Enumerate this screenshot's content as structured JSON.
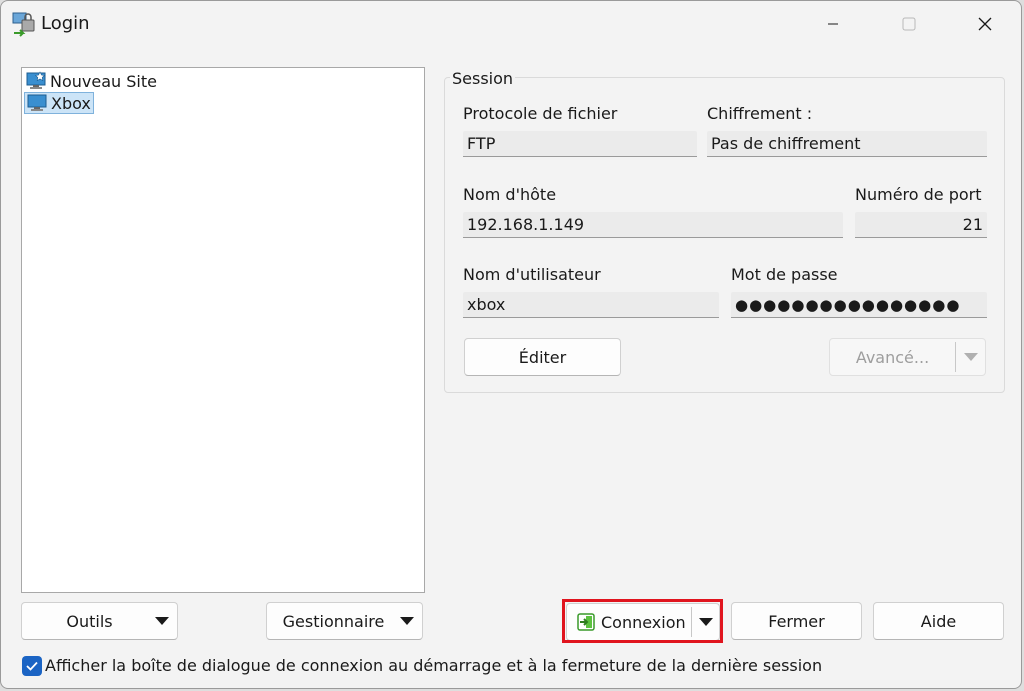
{
  "window": {
    "title": "Login"
  },
  "title_buttons": {
    "minimize": "minimize-icon",
    "maximize": "maximize-icon",
    "close": "close-icon"
  },
  "sites": [
    {
      "label": "Nouveau Site",
      "icon": "new-site-icon",
      "selected": false
    },
    {
      "label": "Xbox",
      "icon": "computer-icon",
      "selected": true
    }
  ],
  "session": {
    "group_title": "Session",
    "protocol_label": "Protocole de fichier",
    "protocol_value": "FTP",
    "encryption_label": "Chiffrement :",
    "encryption_value": "Pas de chiffrement",
    "host_label": "Nom d'hôte",
    "host_value": "192.168.1.149",
    "port_label": "Numéro de port",
    "port_value": "21",
    "user_label": "Nom d'utilisateur",
    "user_value": "xbox",
    "password_label": "Mot de passe",
    "password_value": "●●●●●●●●●●●●●●●●",
    "edit_button": "Éditer",
    "advanced_button": "Avancé..."
  },
  "footer": {
    "tools_button": "Outils",
    "manager_button": "Gestionnaire",
    "connect_button": "Connexion",
    "close_button": "Fermer",
    "help_button": "Aide",
    "show_dialog_checkbox": "Afficher la boîte de dialogue de connexion au démarrage et à la fermeture de la dernière session",
    "show_dialog_checked": true
  },
  "colors": {
    "highlight": "#e0141e",
    "accent": "#1b64c4",
    "selection": "#cce4f7"
  }
}
